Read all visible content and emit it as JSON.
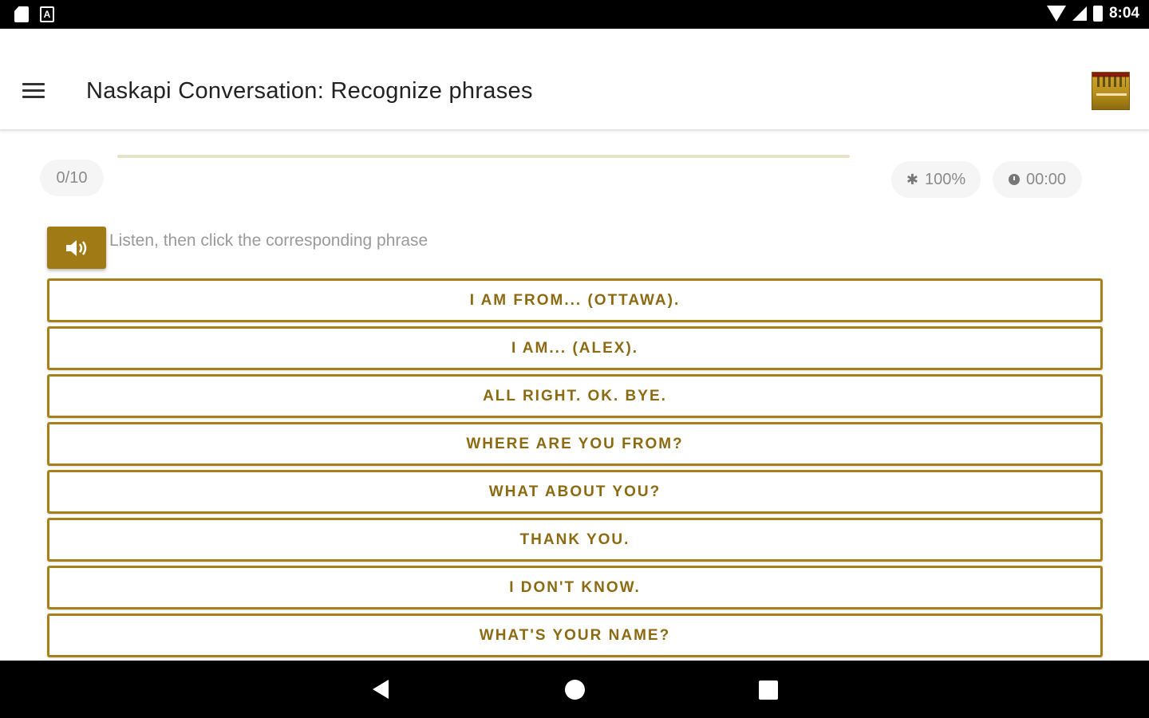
{
  "status_bar": {
    "time": "8:04",
    "left_icons": [
      "sd-card-icon",
      "accessibility-icon"
    ],
    "right_icons": [
      "wifi-icon",
      "cell-signal-icon",
      "battery-icon"
    ]
  },
  "app_bar": {
    "title": "Naskapi Conversation: Recognize phrases",
    "menu_icon": "hamburger-menu-icon",
    "logo_icon": "app-logo-icon"
  },
  "quiz": {
    "progress_fraction": 0.0,
    "counter": "0/10",
    "accuracy": "100%",
    "accuracy_icon": "star-icon",
    "timer": "00:00",
    "timer_icon": "clock-icon",
    "audio_icon": "speaker-icon",
    "instruction": "Listen, then click the corresponding phrase",
    "options": [
      "I AM FROM... (OTTAWA).",
      "I AM... (ALEX).",
      "ALL RIGHT. OK. BYE.",
      "WHERE ARE YOU FROM?",
      "WHAT ABOUT YOU?",
      "THANK YOU.",
      "I DON'T KNOW.",
      "WHAT'S YOUR NAME?"
    ]
  },
  "colors": {
    "accent": "#a07a14",
    "option_border": "#a78118",
    "option_text": "#8c6a12",
    "progress_track": "#e9e2c9"
  },
  "nav_bar": {
    "icons": [
      "back-icon",
      "home-icon",
      "recent-apps-icon"
    ]
  }
}
